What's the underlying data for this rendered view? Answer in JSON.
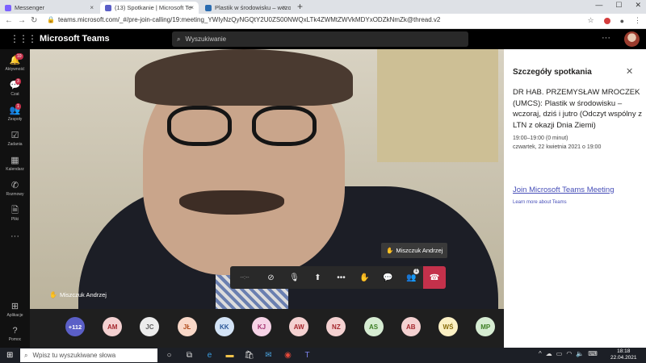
{
  "browser": {
    "tabs": [
      {
        "title": "Messenger",
        "fav_color": "#7b61ff"
      },
      {
        "title": "(13) Spotkanie | Microsoft Te",
        "fav_color": "#5b5fc7"
      },
      {
        "title": "Plastik w środowisku – wczoraj, d",
        "fav_color": "#2b6cb0"
      }
    ],
    "url": "teams.microsoft.com/_#/pre-join-calling/19:meeting_YWIyNzQyNGQtY2U0ZS00NWQxLTk4ZWMtZWVkMDYxODZkNmZk@thread.v2"
  },
  "teams": {
    "app_title": "Microsoft Teams",
    "search_placeholder": "Wyszukiwanie",
    "rail": [
      {
        "icon": "bell-icon",
        "label": "Aktywność",
        "badge": "10"
      },
      {
        "icon": "chat-icon",
        "label": "Czat",
        "badge": "3"
      },
      {
        "icon": "teams-icon",
        "label": "Zespoły",
        "badge": "1"
      },
      {
        "icon": "tasks-icon",
        "label": "Zadania",
        "badge": ""
      },
      {
        "icon": "calendar-icon",
        "label": "Kalendarz",
        "badge": ""
      },
      {
        "icon": "calls-icon",
        "label": "Rozmowy",
        "badge": ""
      },
      {
        "icon": "files-icon",
        "label": "Pliki",
        "badge": ""
      },
      {
        "icon": "more-icon",
        "label": "",
        "badge": ""
      },
      {
        "icon": "apps-icon",
        "label": "Aplikacje",
        "badge": ""
      },
      {
        "icon": "help-icon",
        "label": "Pomoc",
        "badge": ""
      }
    ]
  },
  "video": {
    "speaker_name": "Miszczuk Andrzej",
    "raised_hand_tooltip": "Miszczuk Andrzej"
  },
  "controls": {
    "timer": "--:--",
    "participant_count": "1",
    "icons": [
      "camera-off-icon",
      "mic-off-icon",
      "share-screen-icon",
      "more-icon",
      "raise-hand-icon",
      "chat-icon",
      "participants-icon",
      "hang-up-icon"
    ]
  },
  "participants": [
    {
      "initials": "+112",
      "bg": "#5b5fc7",
      "fg": "#ffffff"
    },
    {
      "initials": "AM",
      "bg": "#f4d1d1",
      "fg": "#a4262c"
    },
    {
      "initials": "JC",
      "bg": "#ececec",
      "fg": "#616161"
    },
    {
      "initials": "JŁ",
      "bg": "#f9d8c8",
      "fg": "#b34f1f"
    },
    {
      "initials": "KK",
      "bg": "#d3e3f6",
      "fg": "#2b5797"
    },
    {
      "initials": "KJ",
      "bg": "#f6d3e6",
      "fg": "#a3316f"
    },
    {
      "initials": "AW",
      "bg": "#f4d1d1",
      "fg": "#a4262c"
    },
    {
      "initials": "NZ",
      "bg": "#f4d1d1",
      "fg": "#a4262c"
    },
    {
      "initials": "AS",
      "bg": "#d6ecd2",
      "fg": "#3b7d23"
    },
    {
      "initials": "AB",
      "bg": "#f4d1d1",
      "fg": "#a4262c"
    },
    {
      "initials": "WŚ",
      "bg": "#fbf0c4",
      "fg": "#8a6d0b"
    },
    {
      "initials": "MP",
      "bg": "#d6ecd2",
      "fg": "#3b7d23"
    }
  ],
  "panel": {
    "title": "Szczegóły spotkania",
    "meeting_name": "DR HAB. PRZEMYSŁAW MROCZEK (UMCS): Plastik w środowisku – wczoraj, dziś i jutro (Odczyt wspólny z LTN z okazji Dnia Ziemi)",
    "time": "19:00–19:00 (0 minut)",
    "date": "czwartek, 22 kwietnia 2021 o 19:00",
    "join_link": "Join Microsoft Teams Meeting",
    "learn_more": "Learn more about Teams"
  },
  "taskbar": {
    "search_placeholder": "Wpisz tu wyszukiwane słowa",
    "time": "18:18",
    "date": "22.04.2021"
  }
}
